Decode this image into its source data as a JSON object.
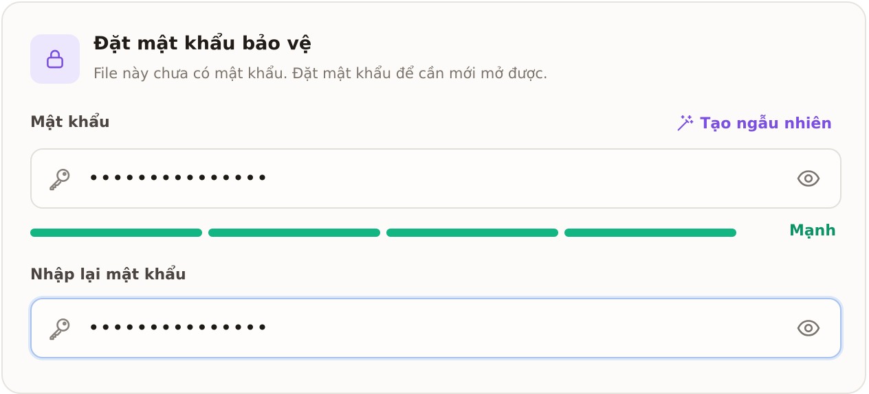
{
  "header": {
    "title": "Đặt mật khẩu bảo vệ",
    "subtitle": "File này chưa có mật khẩu. Đặt mật khẩu để cần mới mở được.",
    "icon": "lock-icon"
  },
  "password": {
    "label": "Mật khẩu",
    "value": "•••••••••••••••",
    "generate_label": "Tạo ngẫu nhiên",
    "generate_icon": "magic-wand-icon"
  },
  "strength": {
    "label": "Mạnh",
    "filled_segments": 4,
    "total_segments": 4,
    "color": "#13b583"
  },
  "confirm": {
    "label": "Nhập lại mật khẩu",
    "value": "•••••••••••••••"
  },
  "colors": {
    "accent": "#7b4fe0",
    "strength_text": "#0d9466",
    "focus_border": "#a8c2ee"
  }
}
